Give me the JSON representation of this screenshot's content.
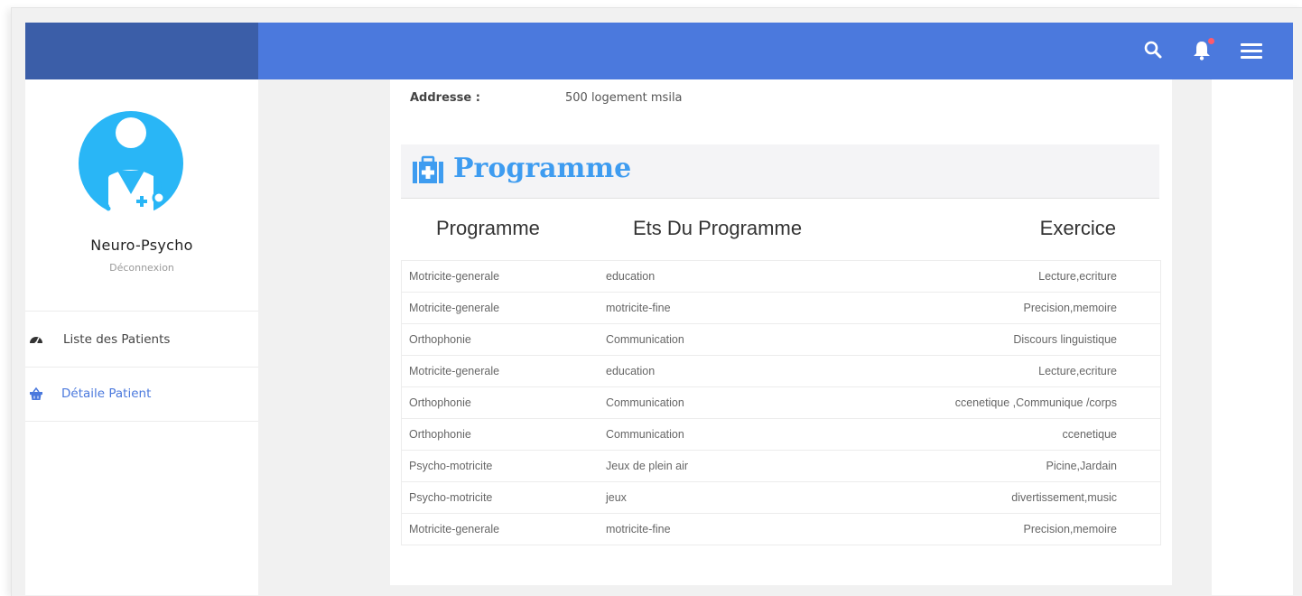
{
  "app": {
    "brand_name": "Neuro-Psycho",
    "logout_label": "Déconnexion"
  },
  "topbar": {
    "icons": [
      "search-icon",
      "bell-icon",
      "menu-icon"
    ],
    "accent": "#4b79dd",
    "left_block": "#3b5ea8"
  },
  "sidebar": {
    "items": [
      {
        "label": "Liste des Patients",
        "icon": "dashboard-icon"
      },
      {
        "label": "Détaile Patient",
        "icon": "basket-icon",
        "active": true
      }
    ]
  },
  "patient": {
    "address_label": "Addresse :",
    "address_value": "500 logement msila"
  },
  "section": {
    "title": "Programme",
    "icon": "medkit-icon",
    "title_color": "#3e9cf0"
  },
  "table": {
    "headers": [
      "Programme",
      "Ets Du Programme",
      "Exercice"
    ],
    "rows": [
      [
        "Motricite-generale",
        "education",
        "Lecture,ecriture"
      ],
      [
        "Motricite-generale",
        "motricite-fine",
        "Precision,memoire"
      ],
      [
        "Orthophonie",
        "Communication",
        "Discours linguistique"
      ],
      [
        "Motricite-generale",
        "education",
        "Lecture,ecriture"
      ],
      [
        "Orthophonie",
        "Communication",
        "ccenetique ,Communique /corps"
      ],
      [
        "Orthophonie",
        "Communication",
        "ccenetique"
      ],
      [
        "Psycho-motricite",
        "Jeux de plein air",
        "Picine,Jardain"
      ],
      [
        "Psycho-motricite",
        "jeux",
        "divertissement,music"
      ],
      [
        "Motricite-generale",
        "motricite-fine",
        "Precision,memoire"
      ]
    ]
  }
}
